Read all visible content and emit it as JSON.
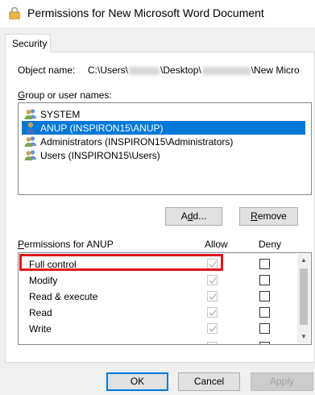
{
  "window": {
    "title": "Permissions for New Microsoft Word Document"
  },
  "tabs": [
    {
      "label": "Security"
    }
  ],
  "object": {
    "label": "Object name:",
    "path_prefix": "C:\\Users\\",
    "path_mid": "\\Desktop\\",
    "path_suffix": "\\New Micro"
  },
  "groups": {
    "label_ul": "G",
    "label_rest": "roup or user names:",
    "items": [
      {
        "name": "SYSTEM",
        "selected": false
      },
      {
        "name": "ANUP (INSPIRON15\\ANUP)",
        "selected": true
      },
      {
        "name": "Administrators (INSPIRON15\\Administrators)",
        "selected": false
      },
      {
        "name": "Users (INSPIRON15\\Users)",
        "selected": false
      }
    ],
    "add_ul": "d",
    "add_pre": "A",
    "add_post": "d...",
    "remove_ul": "R",
    "remove_post": "emove"
  },
  "permissions": {
    "label_ul": "P",
    "label_rest": "ermissions for ANUP",
    "allow_header": "Allow",
    "deny_header": "Deny",
    "rows": [
      {
        "name": "Full control",
        "allow": true,
        "deny": false
      },
      {
        "name": "Modify",
        "allow": true,
        "deny": false
      },
      {
        "name": "Read & execute",
        "allow": true,
        "deny": false
      },
      {
        "name": "Read",
        "allow": true,
        "deny": false
      },
      {
        "name": "Write",
        "allow": true,
        "deny": false
      }
    ]
  },
  "footer": {
    "ok": "OK",
    "cancel": "Cancel",
    "apply": "Apply"
  },
  "colors": {
    "selection": "#0078d7",
    "highlight_box": "#e0151b",
    "dialog_bg": "#f0f0f0"
  }
}
